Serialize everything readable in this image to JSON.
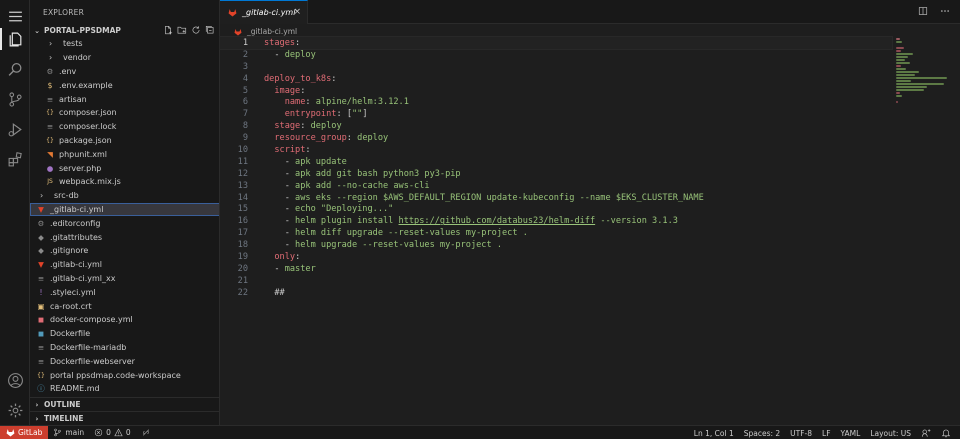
{
  "sidebar": {
    "title": "EXPLORER",
    "project": "PORTAL-PPSDMAP",
    "items": [
      {
        "label": "tests",
        "kind": "folder",
        "icon": "chevron-right-icon"
      },
      {
        "label": "vendor",
        "kind": "folder",
        "icon": "chevron-right-icon"
      },
      {
        "label": ".env",
        "kind": "file",
        "icon": "gear-icon",
        "color": "#8a8a8a"
      },
      {
        "label": ".env.example",
        "kind": "file",
        "icon": "dollar-icon",
        "color": "#e5c07b"
      },
      {
        "label": "artisan",
        "kind": "file",
        "icon": "lines-icon",
        "color": "#8a8a8a"
      },
      {
        "label": "composer.json",
        "kind": "file",
        "icon": "braces-icon",
        "color": "#e5c07b"
      },
      {
        "label": "composer.lock",
        "kind": "file",
        "icon": "lines-icon",
        "color": "#8a8a8a"
      },
      {
        "label": "package.json",
        "kind": "file",
        "icon": "braces-icon",
        "color": "#e5c07b"
      },
      {
        "label": "phpunit.xml",
        "kind": "file",
        "icon": "rss-icon",
        "color": "#e37933"
      },
      {
        "label": "server.php",
        "kind": "file",
        "icon": "php-elephant-icon",
        "color": "#a074c4"
      },
      {
        "label": "webpack.mix.js",
        "kind": "file",
        "icon": "js-icon",
        "color": "#e5c07b"
      },
      {
        "label": "src-db",
        "kind": "folder-root",
        "icon": "chevron-right-icon"
      },
      {
        "label": "_gitlab-ci.yml",
        "kind": "file-root",
        "icon": "gitlab-icon",
        "color": "#e24329",
        "selected": true
      },
      {
        "label": ".editorconfig",
        "kind": "file-root",
        "icon": "gear-icon",
        "color": "#8a8a8a"
      },
      {
        "label": ".gitattributes",
        "kind": "file-root",
        "icon": "git-icon",
        "color": "#8a8a8a"
      },
      {
        "label": ".gitignore",
        "kind": "file-root",
        "icon": "git-icon",
        "color": "#8a8a8a"
      },
      {
        "label": ".gitlab-ci.yml",
        "kind": "file-root",
        "icon": "gitlab-icon",
        "color": "#e24329"
      },
      {
        "label": ".gitlab-ci.yml_xx",
        "kind": "file-root",
        "icon": "lines-icon",
        "color": "#8a8a8a"
      },
      {
        "label": ".styleci.yml",
        "kind": "file-root",
        "icon": "exclamation-icon",
        "color": "#a074c4"
      },
      {
        "label": "ca-root.crt",
        "kind": "file-root",
        "icon": "certificate-icon",
        "color": "#e5c07b"
      },
      {
        "label": "docker-compose.yml",
        "kind": "file-root",
        "icon": "docker-icon",
        "color": "#e06c75"
      },
      {
        "label": "Dockerfile",
        "kind": "file-root",
        "icon": "docker-icon",
        "color": "#519aba"
      },
      {
        "label": "Dockerfile-mariadb",
        "kind": "file-root",
        "icon": "lines-icon",
        "color": "#8a8a8a"
      },
      {
        "label": "Dockerfile-webserver",
        "kind": "file-root",
        "icon": "lines-icon",
        "color": "#8a8a8a"
      },
      {
        "label": "portal ppsdmap.code-workspace",
        "kind": "file-root",
        "icon": "braces-icon",
        "color": "#e5c07b"
      },
      {
        "label": "README.md",
        "kind": "file-root",
        "icon": "info-icon",
        "color": "#519aba"
      }
    ],
    "outline": "OUTLINE",
    "timeline": "TIMELINE"
  },
  "tab": {
    "label": "_gitlab-ci.yml",
    "close": "×"
  },
  "breadcrumb": {
    "file": "_gitlab-ci.yml"
  },
  "code": [
    {
      "n": "1",
      "parts": [
        [
          "key",
          "stages"
        ],
        [
          "plain",
          ":"
        ]
      ],
      "current": true
    },
    {
      "n": "2",
      "parts": [
        [
          "plain",
          "  - "
        ],
        [
          "str",
          "deploy"
        ]
      ]
    },
    {
      "n": "3",
      "parts": []
    },
    {
      "n": "4",
      "parts": [
        [
          "key",
          "deploy_to_k8s"
        ],
        [
          "plain",
          ":"
        ]
      ]
    },
    {
      "n": "5",
      "parts": [
        [
          "plain",
          "  "
        ],
        [
          "key",
          "image"
        ],
        [
          "plain",
          ":"
        ]
      ]
    },
    {
      "n": "6",
      "parts": [
        [
          "plain",
          "    "
        ],
        [
          "key",
          "name"
        ],
        [
          "plain",
          ": "
        ],
        [
          "str",
          "alpine/helm:3.12.1"
        ]
      ]
    },
    {
      "n": "7",
      "parts": [
        [
          "plain",
          "    "
        ],
        [
          "key",
          "entrypoint"
        ],
        [
          "plain",
          ": "
        ],
        [
          "plain",
          "["
        ],
        [
          "str",
          "\"\""
        ],
        [
          "plain",
          "]"
        ]
      ]
    },
    {
      "n": "8",
      "parts": [
        [
          "plain",
          "  "
        ],
        [
          "key",
          "stage"
        ],
        [
          "plain",
          ": "
        ],
        [
          "str",
          "deploy"
        ]
      ]
    },
    {
      "n": "9",
      "parts": [
        [
          "plain",
          "  "
        ],
        [
          "key",
          "resource_group"
        ],
        [
          "plain",
          ": "
        ],
        [
          "str",
          "deploy"
        ]
      ]
    },
    {
      "n": "10",
      "parts": [
        [
          "plain",
          "  "
        ],
        [
          "key",
          "script"
        ],
        [
          "plain",
          ":"
        ]
      ]
    },
    {
      "n": "11",
      "parts": [
        [
          "plain",
          "    - "
        ],
        [
          "str",
          "apk update"
        ]
      ]
    },
    {
      "n": "12",
      "parts": [
        [
          "plain",
          "    - "
        ],
        [
          "str",
          "apk add git bash python3 py3-pip"
        ]
      ]
    },
    {
      "n": "13",
      "parts": [
        [
          "plain",
          "    - "
        ],
        [
          "str",
          "apk add --no-cache aws-cli"
        ]
      ]
    },
    {
      "n": "14",
      "parts": [
        [
          "plain",
          "    - "
        ],
        [
          "str",
          "aws eks --region $AWS_DEFAULT_REGION update-kubeconfig --name $EKS_CLUSTER_NAME"
        ]
      ]
    },
    {
      "n": "15",
      "parts": [
        [
          "plain",
          "    - "
        ],
        [
          "str",
          "echo \"Deploying...\""
        ]
      ]
    },
    {
      "n": "16",
      "parts": [
        [
          "plain",
          "    - "
        ],
        [
          "str",
          "helm plugin install "
        ],
        [
          "lnk",
          "https://github.com/databus23/helm-diff"
        ],
        [
          "str",
          " --version 3.1.3"
        ]
      ]
    },
    {
      "n": "17",
      "parts": [
        [
          "plain",
          "    - "
        ],
        [
          "str",
          "helm diff upgrade --reset-values my-project ."
        ]
      ]
    },
    {
      "n": "18",
      "parts": [
        [
          "plain",
          "    - "
        ],
        [
          "str",
          "helm upgrade --reset-values my-project ."
        ]
      ]
    },
    {
      "n": "19",
      "parts": [
        [
          "plain",
          "  "
        ],
        [
          "key",
          "only"
        ],
        [
          "plain",
          ":"
        ]
      ]
    },
    {
      "n": "20",
      "parts": [
        [
          "plain",
          "  - "
        ],
        [
          "str",
          "master"
        ]
      ]
    },
    {
      "n": "21",
      "parts": []
    },
    {
      "n": "22",
      "parts": [
        [
          "plain",
          "  ##"
        ]
      ]
    }
  ],
  "status": {
    "remote": "GitLab",
    "branch": "main",
    "errors": "0",
    "warnings": "0",
    "position": "Ln 1, Col 1",
    "spaces": "Spaces: 2",
    "encoding": "UTF-8",
    "eol": "LF",
    "language": "YAML",
    "layout": "Layout: US"
  },
  "colors": {
    "accent": "#0078d4",
    "remote": "#cc3e2e",
    "key": "#e06c75",
    "string": "#98c379"
  }
}
